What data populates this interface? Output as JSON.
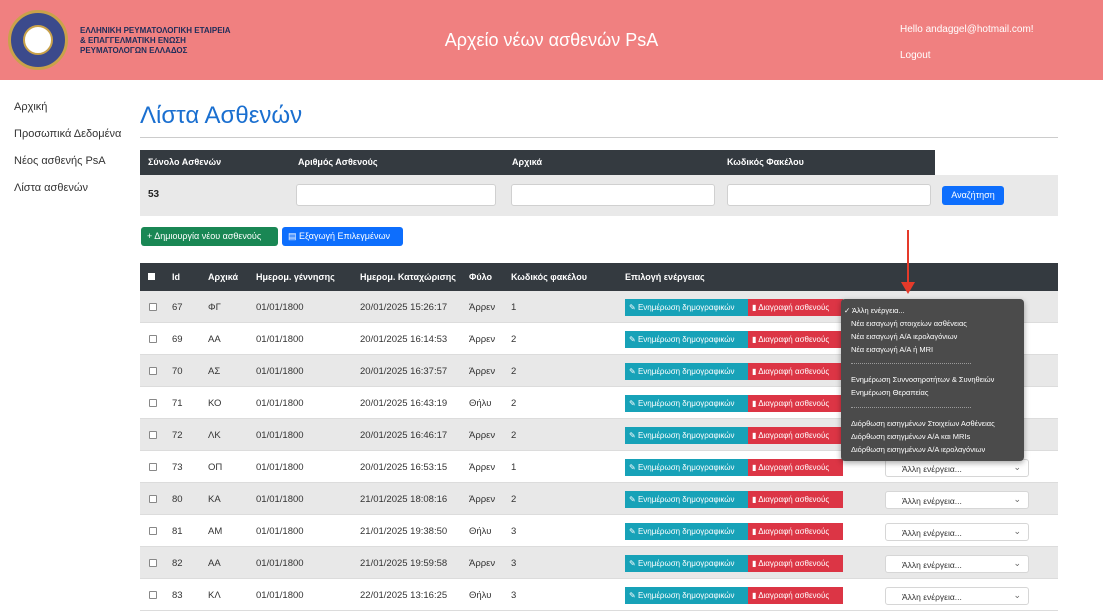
{
  "header": {
    "org_lines": [
      "ΕΛΛΗΝΙΚΗ ΡΕΥΜΑΤΟΛΟΓΙΚΗ ΕΤΑΙΡΕΙΑ",
      "& ΕΠΑΓΓΕΛΜΑΤΙΚΗ ΕΝΩΣΗ",
      "ΡΕΥΜΑΤΟΛΟΓΩΝ ΕΛΛΑΔΟΣ"
    ],
    "app_title": "Αρχείο νέων ασθενών PsA",
    "hello": "Hello andaggel@hotmail.com!",
    "logout": "Logout"
  },
  "sidebar": {
    "items": [
      {
        "label": "Αρχική"
      },
      {
        "label": "Προσωπικά Δεδομένα"
      },
      {
        "label": "Νέος ασθενής PsA"
      },
      {
        "label": "Λίστα ασθενών"
      }
    ]
  },
  "page_title": "Λίστα Ασθενών",
  "search": {
    "headers": {
      "total": "Σύνολο Ασθενών",
      "patient_no": "Αριθμός Ασθενούς",
      "initials": "Αρχικά",
      "file_code": "Κωδικός Φακέλου"
    },
    "total_value": "53",
    "search_button": "Αναζήτηση"
  },
  "actions": {
    "create": "+ Δημιουργία νέου ασθενούς",
    "export": "Εξαγωγή Επιλεγμένων"
  },
  "table": {
    "columns": {
      "id": "Id",
      "initials": "Αρχικά",
      "birth": "Ημερομ. γέννησης",
      "registered": "Ημερομ. Καταχώρισης",
      "sex": "Φύλο",
      "file_code": "Κωδικός φακέλου",
      "action": "Επιλογή ενέργειας"
    },
    "update_label": "Ενημέρωση δημογραφικών",
    "delete_label": "Διαγραφή ασθενούς",
    "select_label": "Άλλη ενέργεια...",
    "rows": [
      {
        "id": "67",
        "initials": "ΦΓ",
        "birth": "01/01/1800",
        "registered": "20/01/2025 15:26:17",
        "sex": "Άρρεν",
        "file_code": "1"
      },
      {
        "id": "69",
        "initials": "ΑΑ",
        "birth": "01/01/1800",
        "registered": "20/01/2025 16:14:53",
        "sex": "Άρρεν",
        "file_code": "2"
      },
      {
        "id": "70",
        "initials": "ΑΣ",
        "birth": "01/01/1800",
        "registered": "20/01/2025 16:37:57",
        "sex": "Άρρεν",
        "file_code": "2"
      },
      {
        "id": "71",
        "initials": "ΚΟ",
        "birth": "01/01/1800",
        "registered": "20/01/2025 16:43:19",
        "sex": "Θήλυ",
        "file_code": "2"
      },
      {
        "id": "72",
        "initials": "ΛΚ",
        "birth": "01/01/1800",
        "registered": "20/01/2025 16:46:17",
        "sex": "Άρρεν",
        "file_code": "2"
      },
      {
        "id": "73",
        "initials": "ΟΠ",
        "birth": "01/01/1800",
        "registered": "20/01/2025 16:53:15",
        "sex": "Άρρεν",
        "file_code": "1"
      },
      {
        "id": "80",
        "initials": "ΚΑ",
        "birth": "01/01/1800",
        "registered": "21/01/2025 18:08:16",
        "sex": "Άρρεν",
        "file_code": "2"
      },
      {
        "id": "81",
        "initials": "ΑΜ",
        "birth": "01/01/1800",
        "registered": "21/01/2025 19:38:50",
        "sex": "Θήλυ",
        "file_code": "3"
      },
      {
        "id": "82",
        "initials": "ΑΑ",
        "birth": "01/01/1800",
        "registered": "21/01/2025 19:59:58",
        "sex": "Άρρεν",
        "file_code": "3"
      },
      {
        "id": "83",
        "initials": "ΚΛ",
        "birth": "01/01/1800",
        "registered": "22/01/2025 13:16:25",
        "sex": "Θήλυ",
        "file_code": "3"
      }
    ]
  },
  "dropdown": {
    "items": [
      "✓ Άλλη ενέργεια...",
      "Νέα εισαγωγή στοιχείων ασθένειας",
      "Νέα εισαγωγή Α/Α ιερολαγόνιων",
      "Νέα εισαγωγή Α/Α ή MRI",
      "Ενημέρωση Συννοσηροτήτων & Συνηθειών",
      "Ενημέρωση Θεραπείας",
      "Διόρθωση εισηγμένων Στοιχείων Ασθένειας",
      "Διόρθωση εισηγμένων Α/Α και MRIs",
      "Διόρθωση εισηγμένων Α/Α ιερολαγόνιων"
    ]
  },
  "colors": {
    "header_bg": "#f08080",
    "title_blue": "#1a6fd0",
    "table_head": "#343a40",
    "update_btn": "#17a2b8",
    "delete_btn": "#dc3545",
    "create_btn": "#198754",
    "primary_btn": "#0d6efd",
    "annotation_arrow": "#e53a2a"
  },
  "icons": [
    "logo-emblem",
    "edit-icon",
    "trash-icon",
    "export-icon",
    "chevron-down-icon",
    "checkmark-icon",
    "annotation-arrow"
  ]
}
